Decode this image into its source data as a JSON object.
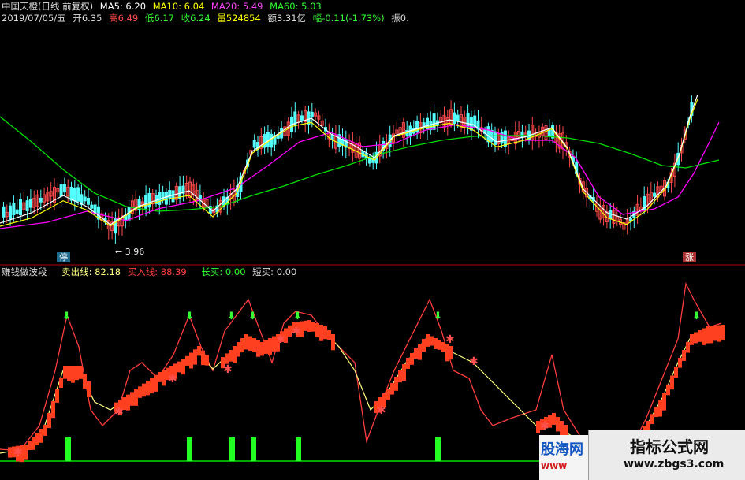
{
  "header": {
    "stock_name": "中国天橙(日线 前复权)",
    "ma5": "MA5: 6.20",
    "ma10": "MA10: 6.04",
    "ma20": "MA20: 5.49",
    "ma60": "MA60: 5.03",
    "date": "2019/07/05/五",
    "open": "开6.35",
    "high": "高6.49",
    "low": "低6.17",
    "close": "收6.24",
    "volume": "量524854",
    "amount": "额3.31亿",
    "change": "幅-0.11(-1.73%)",
    "swing": "振0."
  },
  "indicator": {
    "name": "赚钱做波段",
    "sell_line": "卖出线: 82.18",
    "buy_line": "买入线: 88.39",
    "long_buy": "长买: 0.00",
    "short_buy": "短买: 0.00"
  },
  "markers": {
    "stop": "停",
    "up": "涨",
    "low_price": "← 3.96"
  },
  "watermarks": {
    "left_title": "股海网",
    "left_url": "www",
    "right_title": "指标公式网",
    "right_url": "www.zbgs3.com"
  },
  "colors": {
    "background": "#000000",
    "up_candle": "#ff4a4a",
    "down_candle": "#54ffff",
    "ma5": "#ffffff",
    "ma10": "#ffff00",
    "ma20": "#ff00ff",
    "ma60": "#00e000",
    "sell_line": "#ffff7f",
    "buy_line": "#ff3d3d",
    "long_buy": "#00e000",
    "short_buy": "#e0e0e0",
    "separator": "#b00000"
  }
}
